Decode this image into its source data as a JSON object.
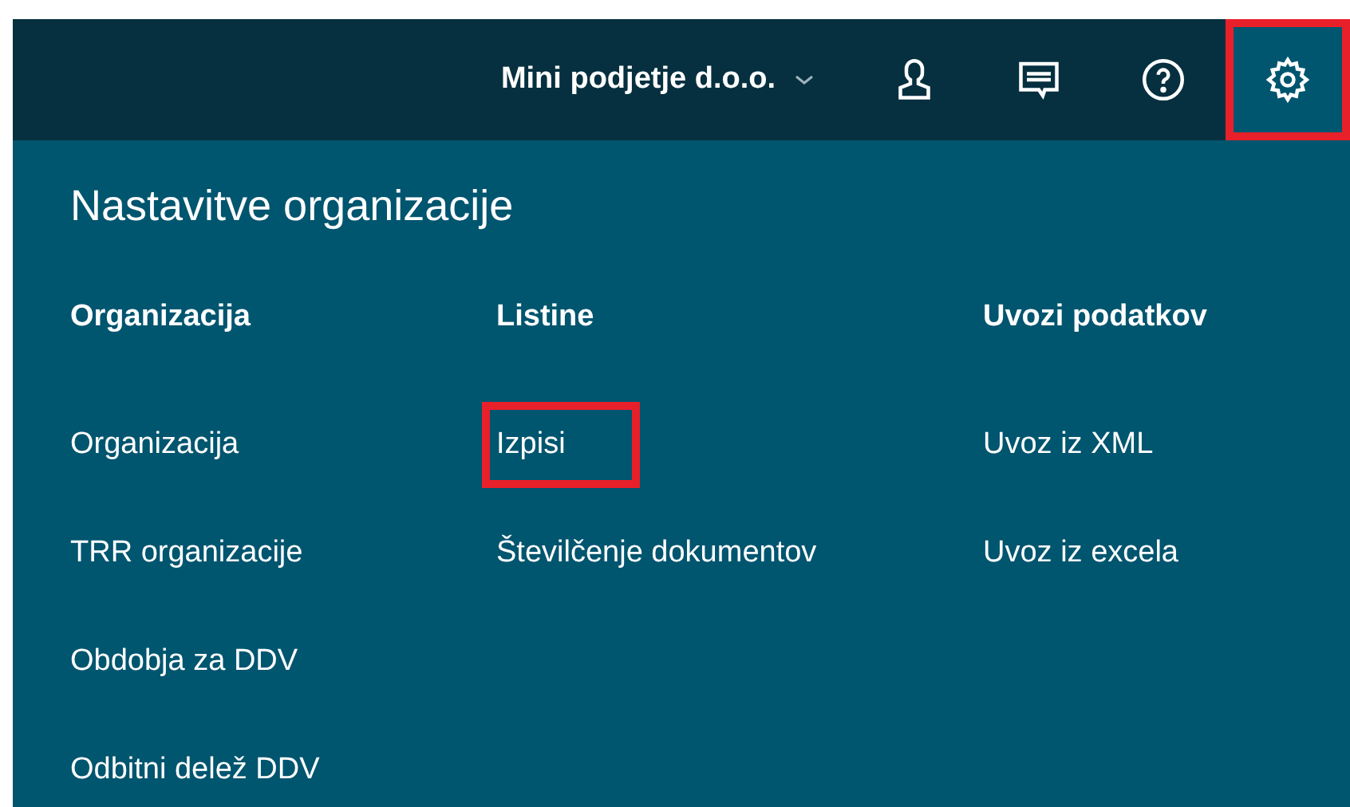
{
  "top_bar": {
    "company": "Mini podjetje d.o.o.",
    "icons": [
      {
        "kind": "user",
        "selected": false,
        "highlighted": false
      },
      {
        "kind": "messages",
        "selected": false,
        "highlighted": false
      },
      {
        "kind": "help",
        "selected": false,
        "highlighted": false
      },
      {
        "kind": "settings",
        "selected": true,
        "highlighted": true
      }
    ]
  },
  "panel": {
    "title": "Nastavitve organizacije",
    "columns": [
      {
        "heading": "Organizacija",
        "items": [
          {
            "label": "Organizacija",
            "highlighted": false
          },
          {
            "label": "TRR organizacije",
            "highlighted": false
          },
          {
            "label": "Obdobja za DDV",
            "highlighted": false
          },
          {
            "label": "Odbitni delež DDV",
            "highlighted": false
          }
        ]
      },
      {
        "heading": "Listine",
        "items": [
          {
            "label": "Izpisi",
            "highlighted": true
          },
          {
            "label": "Številčenje dokumentov",
            "highlighted": false
          }
        ]
      },
      {
        "heading": "Uvozi podatkov",
        "items": [
          {
            "label": "Uvoz iz XML",
            "highlighted": false
          },
          {
            "label": "Uvoz iz excela",
            "highlighted": false
          }
        ]
      }
    ]
  }
}
